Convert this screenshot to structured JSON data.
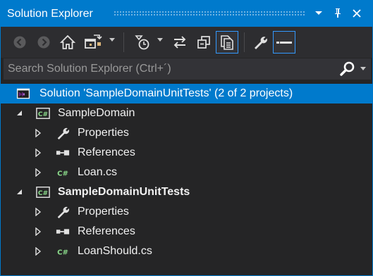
{
  "titlebar": {
    "title": "Solution Explorer",
    "dropdown_glyph": "▾",
    "pin_glyph": "⊓",
    "close_glyph": "✕"
  },
  "toolbar": {
    "buttons": [
      {
        "name": "back-icon",
        "enabled": false
      },
      {
        "name": "forward-icon",
        "enabled": false
      },
      {
        "name": "home-icon",
        "enabled": true
      },
      {
        "name": "switch-views-icon",
        "enabled": true
      },
      {
        "name": "pending-changes-filter-icon",
        "enabled": true
      },
      {
        "name": "sync-with-active-document-icon",
        "enabled": true
      },
      {
        "name": "collapse-all-icon",
        "enabled": true
      },
      {
        "name": "show-all-files-icon",
        "enabled": true,
        "pressed": true
      },
      {
        "name": "properties-wrench-icon",
        "enabled": true
      },
      {
        "name": "preview-selected-items-icon",
        "enabled": true,
        "pressed": true
      }
    ]
  },
  "search": {
    "placeholder": "Search Solution Explorer (Ctrl+´)"
  },
  "tree": {
    "solution": {
      "label": "Solution 'SampleDomainUnitTests' (2 of 2 projects)",
      "selected": true
    },
    "projects": [
      {
        "label": "SampleDomain",
        "bold": false,
        "lang_badge": "C#",
        "children": [
          {
            "label": "Properties",
            "icon": "wrench-icon"
          },
          {
            "label": "References",
            "icon": "references-icon"
          },
          {
            "label": "Loan.cs",
            "icon": "csharp-file-icon",
            "badge": "C#"
          }
        ]
      },
      {
        "label": "SampleDomainUnitTests",
        "bold": true,
        "lang_badge": "C#",
        "children": [
          {
            "label": "Properties",
            "icon": "wrench-icon"
          },
          {
            "label": "References",
            "icon": "references-icon"
          },
          {
            "label": "LoanShould.cs",
            "icon": "csharp-file-icon",
            "badge": "C#"
          }
        ]
      }
    ]
  },
  "colors": {
    "accent": "#007acc",
    "background": "#252526",
    "toolbar": "#2d2d30",
    "text": "#f1f1f1",
    "csharp_green": "#8ad98a"
  }
}
